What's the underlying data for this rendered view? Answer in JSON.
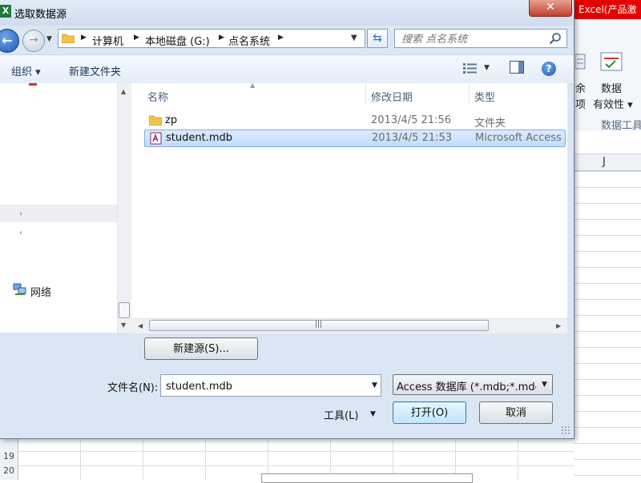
{
  "dialog": {
    "title": "选取数据源",
    "app_icon": "X",
    "close_glyph": "✕"
  },
  "address": {
    "crumbs": [
      "计算机",
      "本地磁盘 (G:)",
      "点名系统"
    ]
  },
  "search": {
    "placeholder": "搜索 点名系统"
  },
  "toolbar": {
    "organize_label": "组织 ▾",
    "new_folder_label": "新建文件夹",
    "help_glyph": "?"
  },
  "nav_pane": {
    "network_label": "网络"
  },
  "file_list": {
    "columns": [
      "名称",
      "修改日期",
      "类型"
    ],
    "rows": [
      {
        "name": "zp",
        "modified": "2013/4/5 21:56",
        "type": "文件夹",
        "icon": "folder-icon"
      },
      {
        "name": "student.mdb",
        "modified": "2013/4/5 21:53",
        "type": "Microsoft Access",
        "icon": "access-db-icon",
        "selected": true
      }
    ]
  },
  "bottom": {
    "new_source_label": "新建源(S)...",
    "filename_label": "文件名(N):",
    "filename_value": "student.mdb",
    "filetype_value": "Access 数据库 (*.mdb;*.mde;",
    "tools_label": "工具(L)",
    "open_label": "打开(O)",
    "cancel_label": "取消"
  },
  "excel_background": {
    "title_fragment": "Excel(产品激",
    "ribbon_texts": [
      "余",
      "数据",
      "项",
      "有效性 ▾",
      "数据工具"
    ],
    "column_header": "J",
    "row_numbers": [
      "19",
      "20"
    ]
  },
  "colors": {
    "dialog_bg": "#dbe6f4",
    "excel_title_red": "#e60000",
    "selection_blue": "#c1dcfb"
  }
}
